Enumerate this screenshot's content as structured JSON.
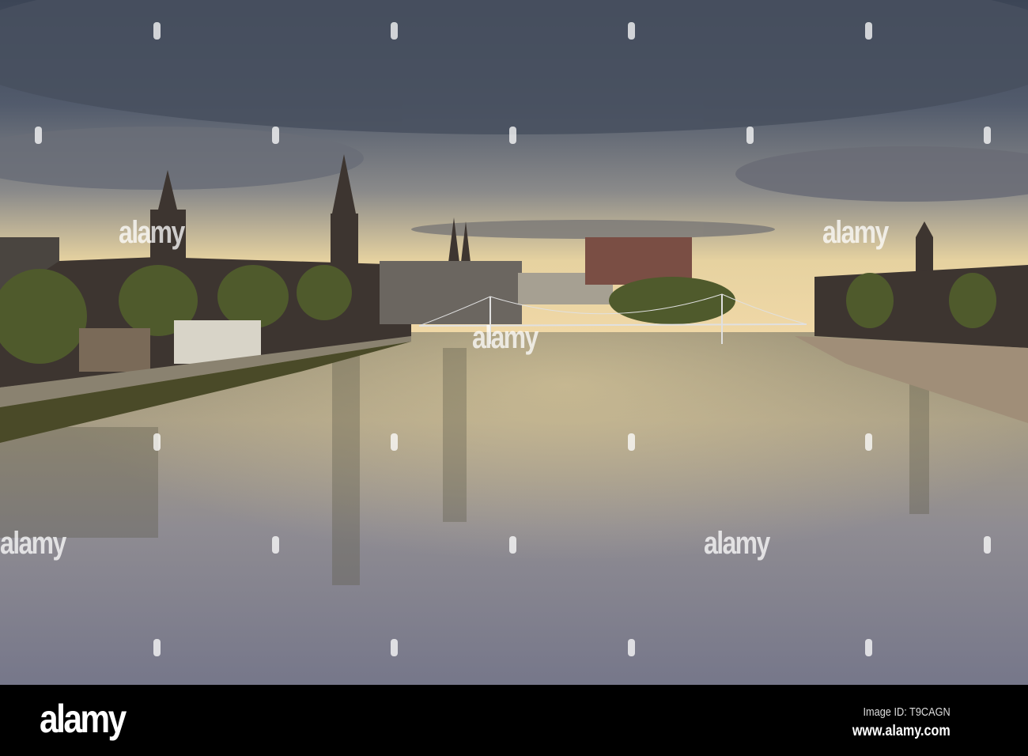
{
  "photo": {
    "subject": "river-town-skyline-at-dusk"
  },
  "watermark": {
    "text": "alamy"
  },
  "footer": {
    "logo": "alamy",
    "image_id": "Image ID: T9CAGN",
    "website": "www.alamy.com"
  }
}
